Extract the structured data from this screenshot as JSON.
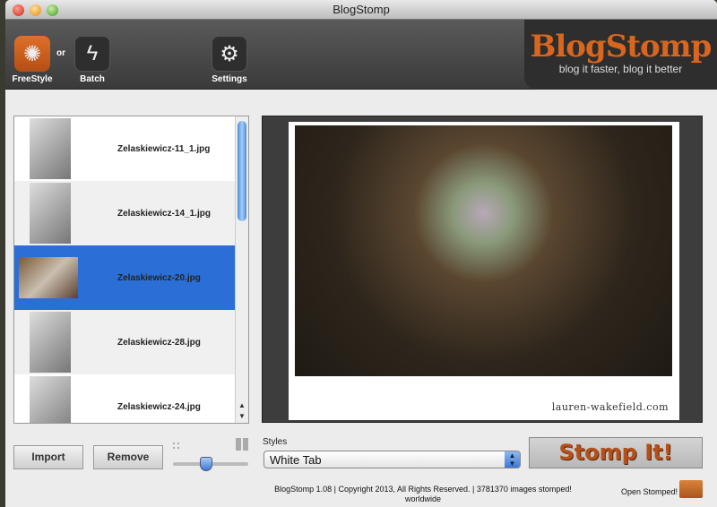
{
  "window": {
    "title": "BlogStomp"
  },
  "toolbar": {
    "freestyle": "FreeStyle",
    "or": "or",
    "batch": "Batch",
    "settings": "Settings"
  },
  "logo": {
    "name": "BlogStomp",
    "tagline": "blog it faster, blog it better"
  },
  "files": [
    {
      "name": "Zelaskiewicz-11_1.jpg",
      "selected": false
    },
    {
      "name": "Zelaskiewicz-14_1.jpg",
      "selected": false
    },
    {
      "name": "Zelaskiewicz-20.jpg",
      "selected": true
    },
    {
      "name": "Zelaskiewicz-28.jpg",
      "selected": false
    },
    {
      "name": "Zelaskiewicz-24.jpg",
      "selected": false
    }
  ],
  "preview": {
    "credit": "lauren-wakefield.com"
  },
  "buttons": {
    "import": "Import",
    "remove": "Remove",
    "stomp": "Stomp It!"
  },
  "styles": {
    "label": "Styles",
    "selected": "White Tab"
  },
  "footer": {
    "line1": "BlogStomp 1.08 | Copyright 2013, All Rights Reserved. | 3781370 images stomped!",
    "line2": "worldwide",
    "open": "Open Stomped!"
  },
  "colors": {
    "selection": "#2b6fd6",
    "accent": "#d8661e"
  }
}
